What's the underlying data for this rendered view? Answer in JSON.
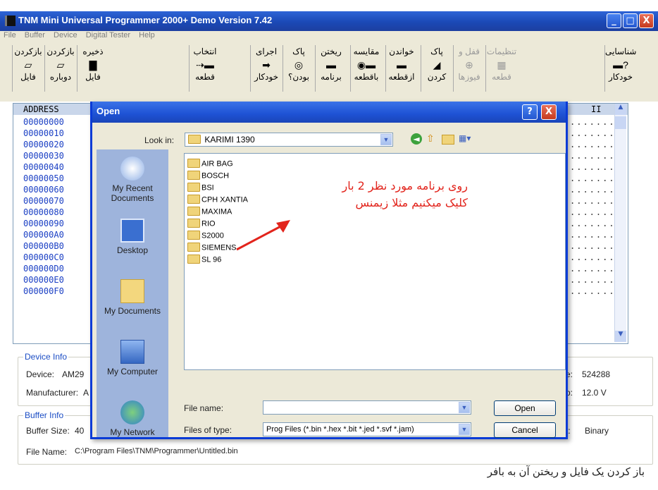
{
  "window": {
    "title": "TNM Mini Universal Programmer 2000+ Demo  Version 7.42",
    "controls": [
      "_",
      "□",
      "X"
    ]
  },
  "menu": [
    "File",
    "Buffer",
    "Device",
    "Digital Tester",
    "Help"
  ],
  "toolbar": [
    {
      "top": "بازکردن",
      "bottom": "فایل",
      "icon": "open-folder-icon",
      "glyph": "▱"
    },
    {
      "top": "بازکردن",
      "bottom": "دوباره",
      "icon": "reopen-folder-icon",
      "glyph": "▱"
    },
    {
      "top": "ذخیره",
      "bottom": "فایل",
      "icon": "save-disk-icon",
      "glyph": "▇"
    },
    {
      "top": "انتخاب",
      "bottom": "قطعه",
      "icon": "select-chip-icon",
      "glyph": "⇢▬"
    },
    {
      "top": "اجرای",
      "bottom": "خودکار",
      "icon": "arrow-right-icon",
      "glyph": "➡"
    },
    {
      "top": "پاک",
      "bottom": "بودن؟",
      "icon": "blank-check-icon",
      "glyph": "◎"
    },
    {
      "top": "ریختن",
      "bottom": "برنامه",
      "icon": "program-chip-icon",
      "glyph": "▬"
    },
    {
      "top": "مقایسه",
      "bottom": "باقطعه",
      "icon": "compare-icon",
      "glyph": "◉▬"
    },
    {
      "top": "خواندن",
      "bottom": "ازقطعه",
      "icon": "read-chip-icon",
      "glyph": "▬"
    },
    {
      "top": "پاک",
      "bottom": "کردن",
      "icon": "erase-icon",
      "glyph": "◢"
    },
    {
      "top": "قفل و",
      "bottom": "فیوزها",
      "icon": "lock-fuse-icon",
      "glyph": "⊕"
    },
    {
      "top": "تنظیمات",
      "bottom": "قطعه",
      "icon": "chip-settings-icon",
      "glyph": "▦"
    },
    {
      "top": "شناسایی",
      "bottom": "خودکار",
      "icon": "auto-detect-icon",
      "glyph": "▬?"
    }
  ],
  "hex": {
    "header": "ADDRESS",
    "ascii_header": "II",
    "addresses": [
      "00000000",
      "00000010",
      "00000020",
      "00000030",
      "00000040",
      "00000050",
      "00000060",
      "00000070",
      "00000080",
      "00000090",
      "000000A0",
      "000000B0",
      "000000C0",
      "000000D0",
      "000000E0",
      "000000F0"
    ],
    "ascii_fill": "........"
  },
  "device_info": {
    "legend": "Device Info",
    "device_label": "Device:",
    "device_value": "AM29",
    "manufacturer_label": "Manufacturer:",
    "manufacturer_value": "A",
    "size_label": "e:",
    "size_value": "524288",
    "voltage_label": "p:",
    "voltage_value": "12.0 V"
  },
  "buffer_info": {
    "legend": "Buffer Info",
    "size_label": "Buffer Size:",
    "size_value": "40",
    "format_label": "t:",
    "format_value": "Binary",
    "file_label": "File Name:",
    "file_value": "C:\\Program Files\\TNM\\Programmer\\Untitled.bin"
  },
  "caption": "باز کردن یک فایل و ریختن آن به بافر",
  "dialog": {
    "title": "Open",
    "help": "?",
    "close": "X",
    "look_in_label": "Look in:",
    "look_in_value": "KARIMI 1390",
    "places": [
      "My Recent Documents",
      "Desktop",
      "My Documents",
      "My Computer",
      "My Network"
    ],
    "folders": [
      "AIR BAG",
      "BOSCH",
      "BSI",
      "CPH XANTIA",
      "MAXIMA",
      "RIO",
      "S2000",
      "SIEMENS",
      "SL 96"
    ],
    "file_name_label": "File name:",
    "file_name_value": "",
    "file_type_label": "Files of type:",
    "file_type_value": "Prog Files (*.bin *.hex *.bit *.jed *.svf *.jam)",
    "open_button": "Open",
    "cancel_button": "Cancel"
  },
  "annotation": {
    "line1": "روی برنامه مورد نظر 2 بار",
    "line2": "کلیک میکنیم مثلا زیمنس",
    "color": "#e2241c"
  }
}
